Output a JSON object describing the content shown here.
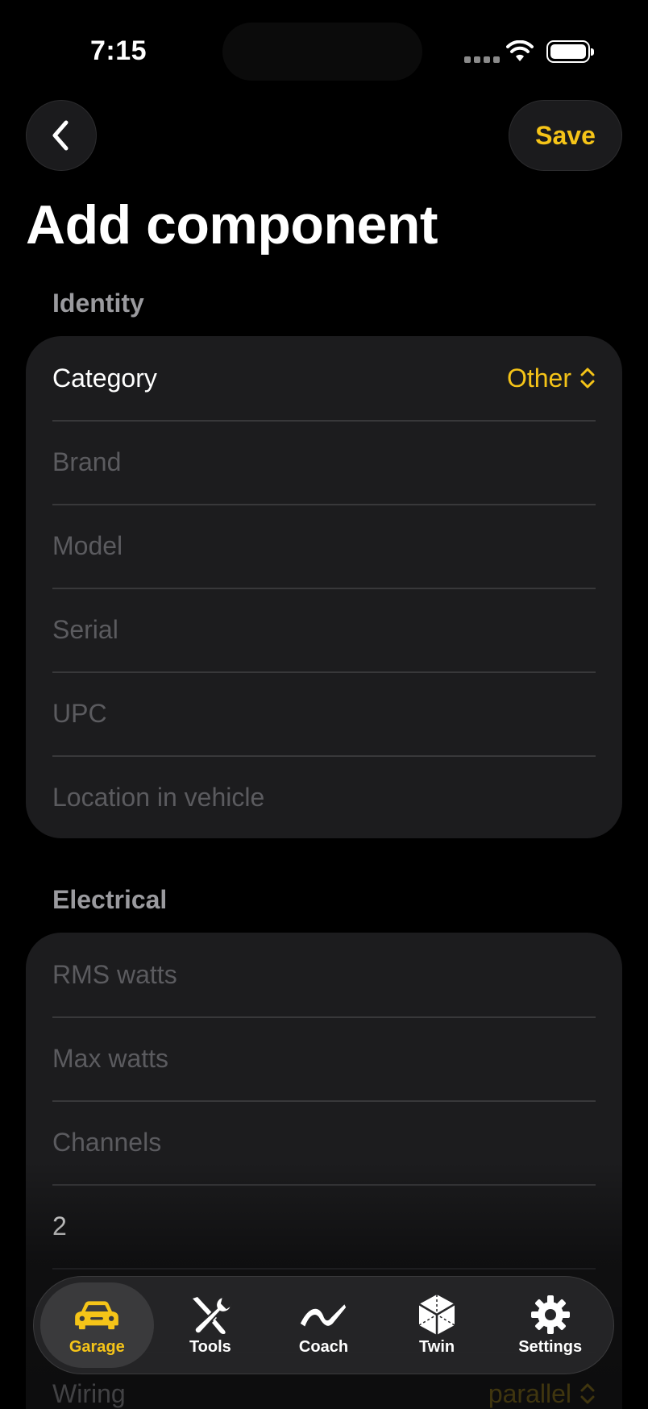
{
  "status_bar": {
    "time": "7:15"
  },
  "nav": {
    "save_label": "Save"
  },
  "page": {
    "title": "Add component"
  },
  "identity": {
    "header": "Identity",
    "category_label": "Category",
    "category_value": "Other",
    "brand_placeholder": "Brand",
    "model_placeholder": "Model",
    "serial_placeholder": "Serial",
    "upc_placeholder": "UPC",
    "location_placeholder": "Location in vehicle"
  },
  "electrical": {
    "header": "Electrical",
    "rms_placeholder": "RMS watts",
    "max_placeholder": "Max watts",
    "channels_placeholder": "Channels",
    "ohms_value": "2",
    "wiring_label": "Wiring",
    "wiring_value": "parallel"
  },
  "tabbar": {
    "tabs": [
      {
        "label": "Garage",
        "icon": "car-icon",
        "active": true
      },
      {
        "label": "Tools",
        "icon": "wrench-screwdriver-icon",
        "active": false
      },
      {
        "label": "Coach",
        "icon": "wave-icon",
        "active": false
      },
      {
        "label": "Twin",
        "icon": "cube-icon",
        "active": false
      },
      {
        "label": "Settings",
        "icon": "gear-icon",
        "active": false
      }
    ]
  },
  "colors": {
    "accent": "#f5c418",
    "card": "#1c1c1e",
    "background": "#000000",
    "placeholder": "#5b5b5f"
  }
}
